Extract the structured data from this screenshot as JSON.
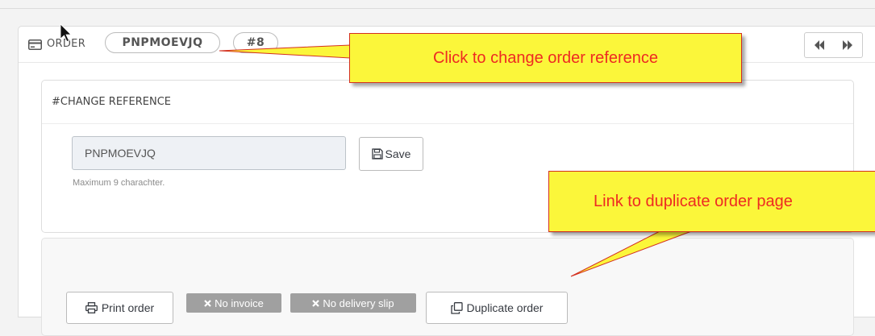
{
  "order_header": {
    "label": "ORDER",
    "reference": "PNPMOEVJQ",
    "number": "#8",
    "icons": {
      "order": "credit-card-icon",
      "prev": "backward-icon",
      "next": "forward-icon"
    }
  },
  "change_reference": {
    "title": "#CHANGE REFERENCE",
    "input_value": "PNPMOEVJQ",
    "save_label": "Save",
    "hint": "Maximum 9 charachter."
  },
  "actions": {
    "print_label": "Print order",
    "no_invoice_label": "No invoice",
    "no_delivery_label": "No delivery slip",
    "duplicate_label": "Duplicate order"
  },
  "callouts": {
    "reference": "Click to change order reference",
    "duplicate": "Link to duplicate order page"
  },
  "colors": {
    "callout_bg": "#fbf63a",
    "callout_text": "#ee2a22",
    "callout_border": "#d32f1f",
    "badge_bg": "#a0a0a0"
  }
}
